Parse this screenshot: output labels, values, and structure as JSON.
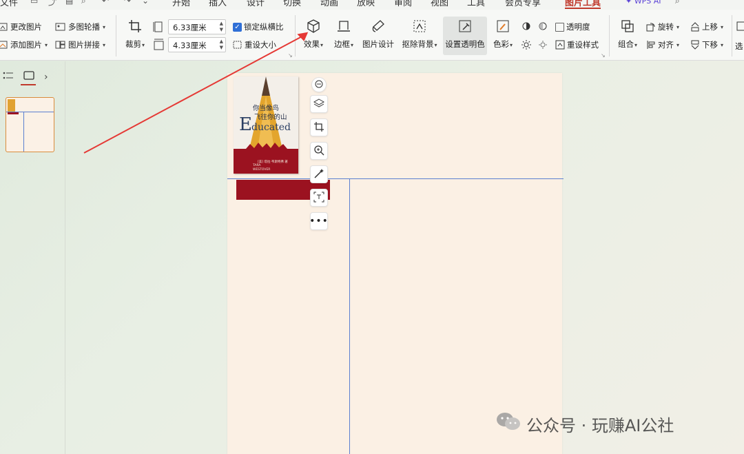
{
  "menu": {
    "file": "文件",
    "items": [
      "开始",
      "插入",
      "设计",
      "切换",
      "动画",
      "放映",
      "审阅",
      "视图",
      "工具",
      "会员专享",
      "图片工具"
    ],
    "active": "图片工具",
    "wps_ai": "WPS AI"
  },
  "ribbon": {
    "change_picture": "更改图片",
    "add_picture": "添加图片",
    "multi_carousel": "多图轮播",
    "picture_collage": "图片拼接",
    "crop": "裁剪",
    "height_value": "6.33厘米",
    "width_value": "4.33厘米",
    "lock_ratio": "锁定纵横比",
    "reset_size": "重设大小",
    "effects": "效果",
    "border": "边框",
    "picture_design": "图片设计",
    "remove_background": "抠除背景",
    "set_transparent_color": "设置透明色",
    "color": "色彩",
    "transparency": "透明度",
    "reset_style": "重设样式",
    "group": "组合",
    "rotate": "旋转",
    "align": "对齐",
    "bring_forward": "上移",
    "send_backward": "下移",
    "select_pane": "选"
  },
  "book": {
    "cn_title_line1": "你当像鸟",
    "cn_title_line2": "飞往你的山",
    "en_title_cap": "E",
    "en_title_rest": "ducated",
    "author_line1": "TARA",
    "author_line2": "WESTOVER",
    "publisher_line": "[美] 塔拉·韦斯特弗 著"
  },
  "watermark": {
    "text": "公众号 · 玩赚AI公社"
  },
  "colors": {
    "accent": "#c0392b",
    "book_red": "#9b1220",
    "guide_blue": "#5a7fd0",
    "arrow_red": "#e53935",
    "page": "#fbf0e4"
  }
}
